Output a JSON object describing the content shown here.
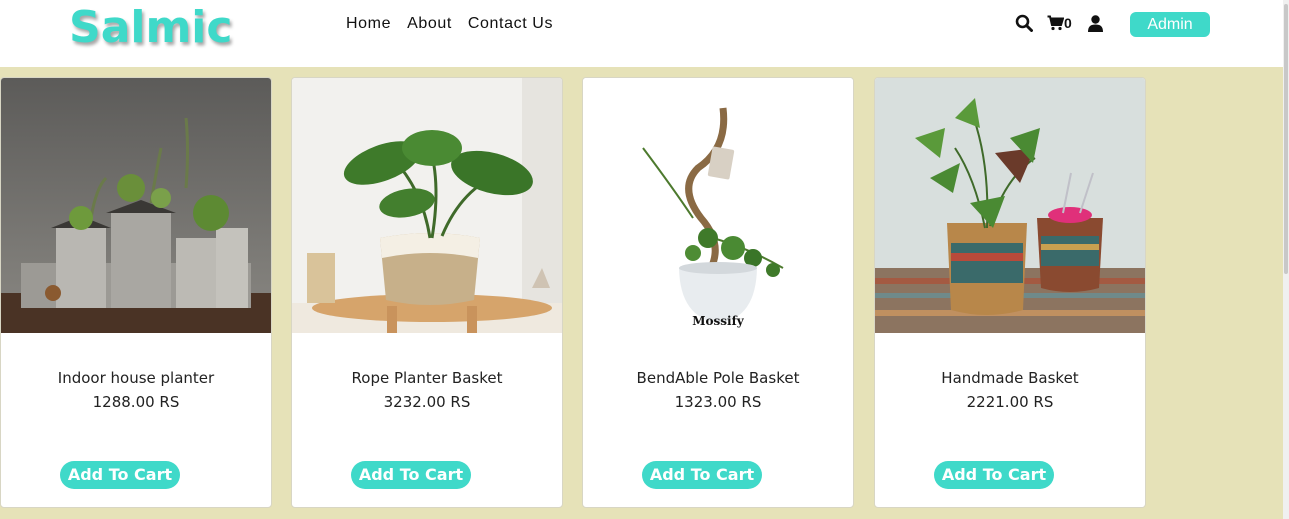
{
  "brand": {
    "logo": "Salmic"
  },
  "nav": {
    "links": [
      "Home",
      "About",
      "Contact Us"
    ],
    "cart_count": "0",
    "admin_label": "Admin"
  },
  "colors": {
    "accent": "#3fd9c9",
    "background": "#e6e2b8"
  },
  "icons": [
    "search-icon",
    "cart-icon",
    "user-icon"
  ],
  "products": [
    {
      "name": "Indoor house planter",
      "price": "1288.00 RS",
      "button": "Add To Cart"
    },
    {
      "name": "Rope Planter Basket",
      "price": "3232.00 RS",
      "button": "Add To Cart"
    },
    {
      "name": "BendAble Pole Basket",
      "price": "1323.00 RS",
      "button": "Add To Cart",
      "image_text": "Mossify"
    },
    {
      "name": "Handmade Basket",
      "price": "2221.00 RS",
      "button": "Add To Cart"
    }
  ]
}
